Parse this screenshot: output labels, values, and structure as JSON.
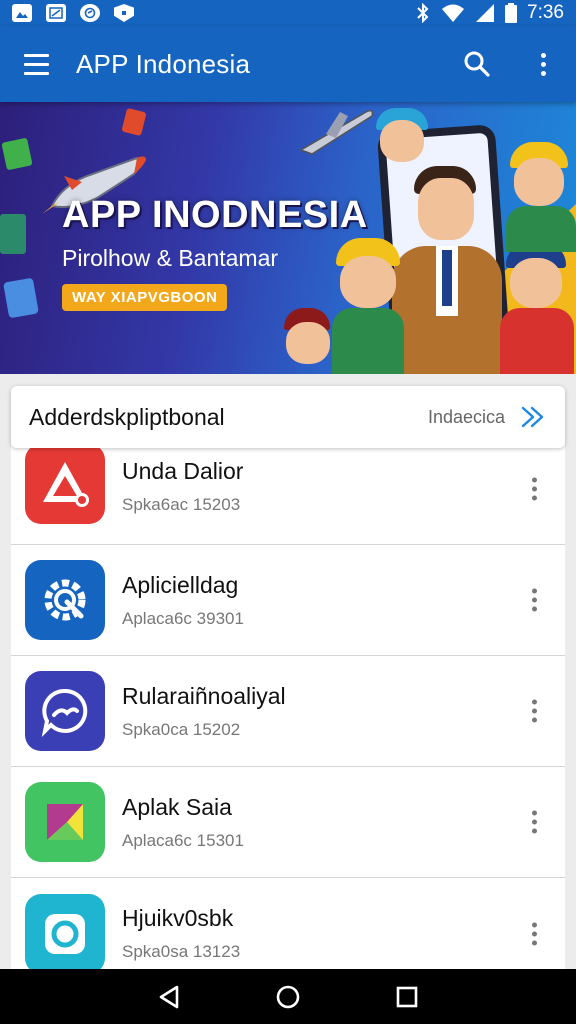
{
  "status_bar": {
    "time": "7:36",
    "left_icons": [
      "gallery-notification-icon",
      "image-notification-icon",
      "sync-notification-icon",
      "shield-notification-icon"
    ],
    "right_icons": [
      "bluetooth-icon",
      "wifi-icon",
      "signal-icon",
      "battery-icon"
    ]
  },
  "app_bar": {
    "title": "APP Indonesia",
    "background": "#1565c0"
  },
  "banner": {
    "title": "APP INODNESIA",
    "subtitle": "Pirolhow & Bantamar",
    "pill": "WAY XIAPVGBOON"
  },
  "section": {
    "title": "Adderdskpliptbonal",
    "link_label": "Indaecica"
  },
  "apps": [
    {
      "name": "Unda Dalior",
      "sub": "Spka6ac  15203",
      "icon": "warning-triangle-icon",
      "color": "#e53935"
    },
    {
      "name": "Aplicielldag",
      "sub": "Aplaca6c  39301",
      "icon": "gear-wrench-icon",
      "color": "#1565c0"
    },
    {
      "name": "Rularaiñnoaliyal",
      "sub": "Spka0ca  15202",
      "icon": "chat-bubble-icon",
      "color": "#3a3fb5"
    },
    {
      "name": "Aplak Saia",
      "sub": "Aplaca6c  15301",
      "icon": "square-leaf-icon",
      "color": "#43c463"
    },
    {
      "name": "Hjuikv0sbk",
      "sub": "Spka0sa  13123",
      "icon": "camera-icon",
      "color": "#1fb5d1"
    }
  ],
  "nav": {
    "back": "back-icon",
    "home": "home-icon",
    "recents": "recents-icon"
  }
}
